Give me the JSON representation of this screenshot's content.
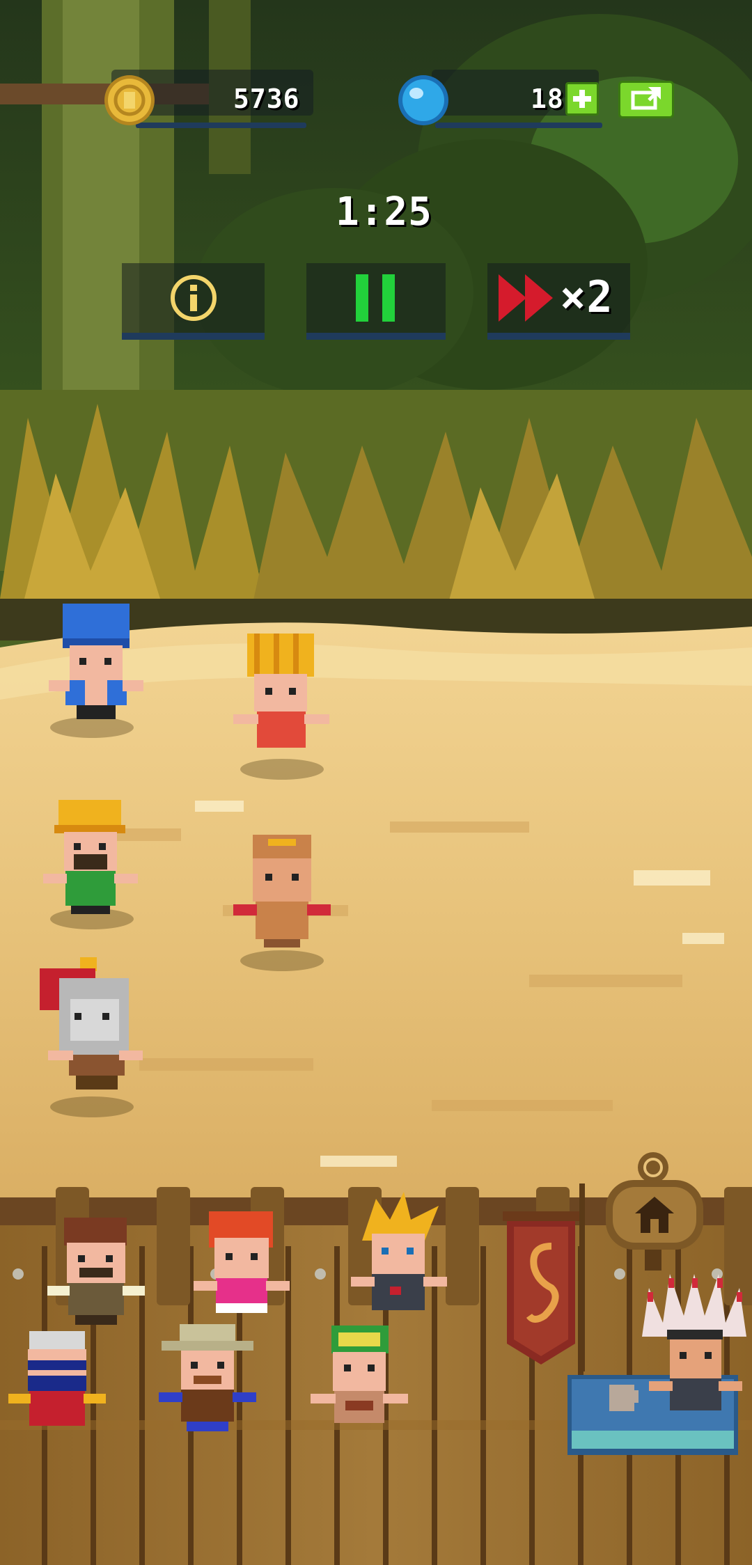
{
  "hud": {
    "coins": "5736",
    "gems": "18",
    "timer": "1:25",
    "speed_multiplier": "×2"
  },
  "icons": {
    "coin": "coin-icon",
    "gem": "gem-icon",
    "add": "plus-icon",
    "share": "share-icon",
    "info": "info-icon",
    "pause": "pause-icon",
    "fast_forward": "fast-forward-icon",
    "home": "home-icon"
  },
  "colors": {
    "coin": "#e8b93a",
    "gem": "#2fa8e8",
    "add_button": "#7bd72c",
    "pause": "#22d13b",
    "fast_forward": "#d51b2c",
    "sand": "#e8c27a",
    "fence": "#a37a3a"
  },
  "characters": {
    "arena": [
      "blue-helmet-fighter",
      "golden-crown-princess",
      "hardhat-bearded-merchant",
      "monk-fighter",
      "red-crested-gladiator"
    ],
    "bench": [
      "brown-haired-farmer",
      "red-haired-girl",
      "spiky-blond-swordsman",
      "masked-bandit",
      "cowboy",
      "green-haired-warrior"
    ],
    "shopkeeper": "feathered-chief"
  }
}
